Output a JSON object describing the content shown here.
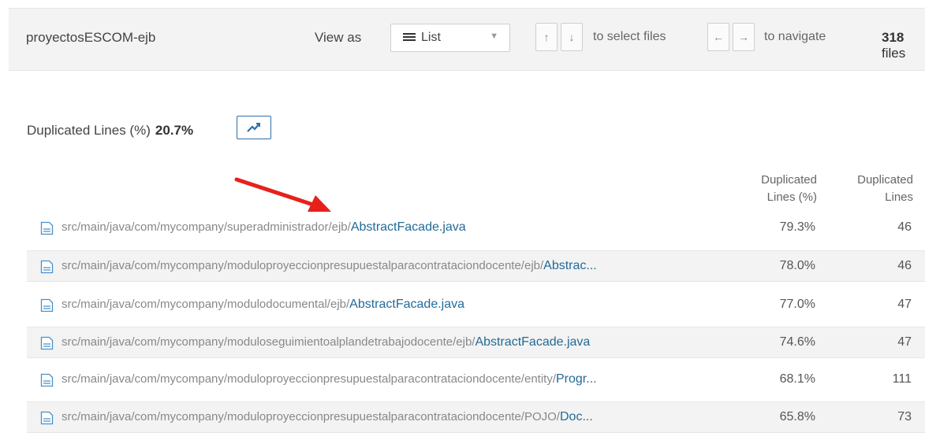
{
  "header": {
    "project": "proyectosESCOM-ejb",
    "view_as_label": "View as",
    "view_value": "List",
    "select_hint": "to select files",
    "navigate_hint": "to navigate",
    "count_value": "318",
    "count_label": "files",
    "up_key": "↑",
    "down_key": "↓",
    "left_key": "←",
    "right_key": "→"
  },
  "metric": {
    "label": "Duplicated Lines (%)",
    "value": "20.7%",
    "trend_icon": "trend-line-icon"
  },
  "columns": {
    "col1_line1": "Duplicated",
    "col1_line2": "Lines (%)",
    "col2_line1": "Duplicated",
    "col2_line2": "Lines"
  },
  "rows": [
    {
      "dir": "src/main/java/com/mycompany/superadministrador/ejb/",
      "name": "AbstractFacade.java",
      "pct": "79.3%",
      "lines": "46"
    },
    {
      "dir": "src/main/java/com/mycompany/moduloproyeccionpresupuestalparacontrataciondocente/ejb/",
      "name": "Abstrac...",
      "pct": "78.0%",
      "lines": "46"
    },
    {
      "dir": "src/main/java/com/mycompany/modulodocumental/ejb/",
      "name": "AbstractFacade.java",
      "pct": "77.0%",
      "lines": "47"
    },
    {
      "dir": "src/main/java/com/mycompany/moduloseguimientoalplandetrabajodocente/ejb/",
      "name": "AbstractFacade.java",
      "pct": "74.6%",
      "lines": "47"
    },
    {
      "dir": "src/main/java/com/mycompany/moduloproyeccionpresupuestalparacontrataciondocente/entity/",
      "name": "Progr...",
      "pct": "68.1%",
      "lines": "111"
    },
    {
      "dir": "src/main/java/com/mycompany/moduloproyeccionpresupuestalparacontrataciondocente/POJO/",
      "name": "Doc...",
      "pct": "65.8%",
      "lines": "73"
    }
  ],
  "colors": {
    "link": "#236a97",
    "accent": "#2f6fa8",
    "annotation_arrow": "#e8201b"
  }
}
